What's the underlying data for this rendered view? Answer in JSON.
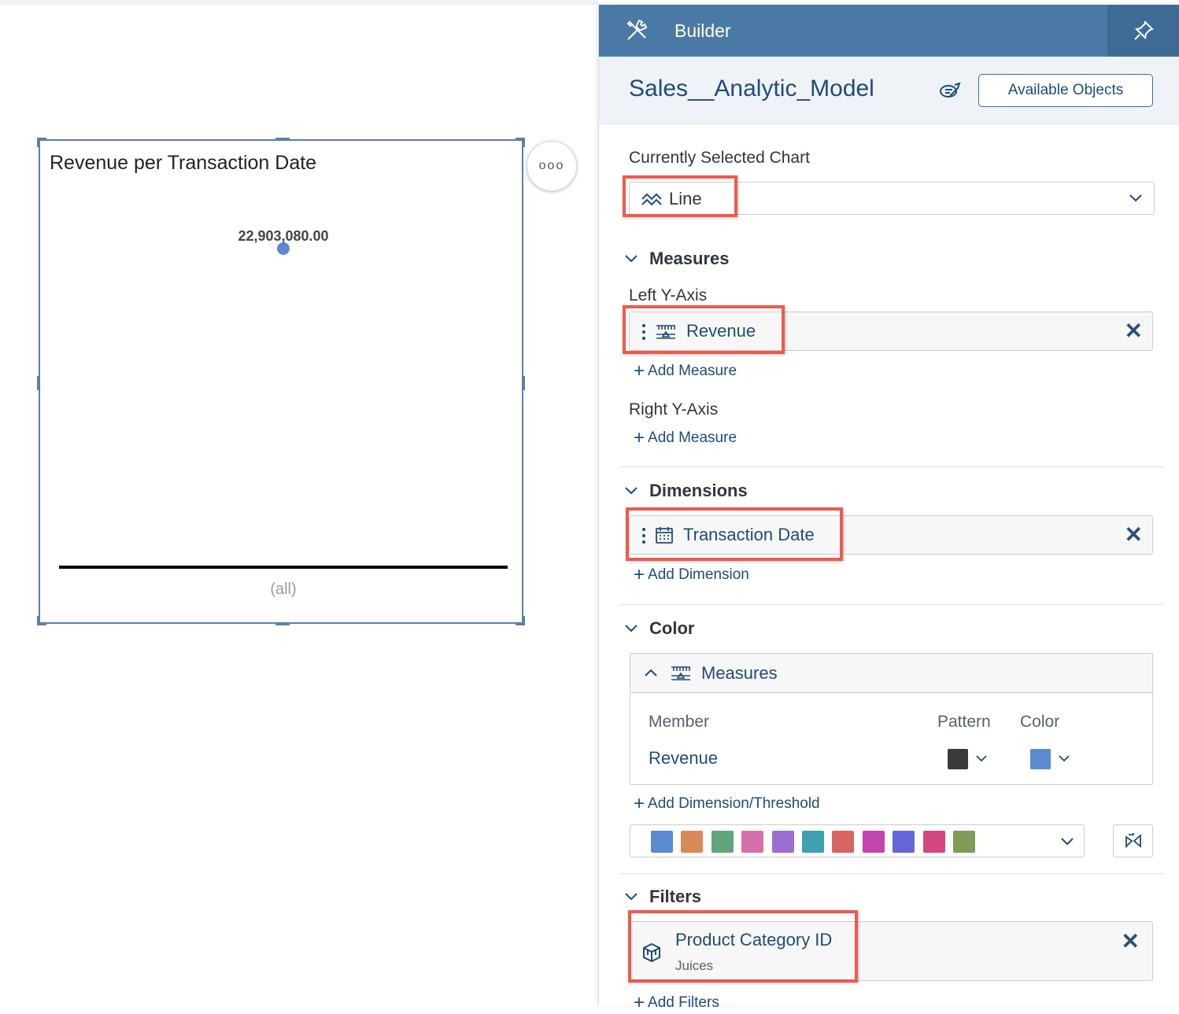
{
  "chart": {
    "title": "Revenue per Transaction Date",
    "more_label": "ooo"
  },
  "chart_data": {
    "type": "line",
    "title": "Revenue per Transaction Date",
    "categories": [
      "(all)"
    ],
    "series": [
      {
        "values": [
          22903080.0
        ]
      }
    ],
    "data_labels": [
      "22,903,080.00"
    ]
  },
  "builder": {
    "title": "Builder",
    "model_name": "Sales__Analytic_Model",
    "available_objects_label": "Available Objects",
    "currently_selected_chart_label": "Currently Selected Chart",
    "chart_type": "Line",
    "measures": {
      "heading": "Measures",
      "left_axis_label": "Left Y-Axis",
      "left_axis_item": "Revenue",
      "add_measure_left": "Add Measure",
      "right_axis_label": "Right Y-Axis",
      "add_measure_right": "Add Measure"
    },
    "dimensions": {
      "heading": "Dimensions",
      "item": "Transaction Date",
      "add_dimension": "Add Dimension"
    },
    "color": {
      "heading": "Color",
      "group_label": "Measures",
      "col_member": "Member",
      "col_pattern": "Pattern",
      "col_color": "Color",
      "member": "Revenue",
      "pattern_color": "#3a3a3a",
      "member_color": "#5b8ad0",
      "add_dimension_threshold": "Add Dimension/Threshold",
      "palette": [
        "#5b8ad0",
        "#d98a55",
        "#61a47a",
        "#d570ad",
        "#9b6ed0",
        "#3fa0b1",
        "#d86464",
        "#c245ad",
        "#6567d8",
        "#d2487f",
        "#7f9d57"
      ]
    },
    "filters": {
      "heading": "Filters",
      "item": "Product Category ID",
      "item_value": "Juices",
      "add_filters": "Add Filters"
    }
  },
  "colors": {
    "accent": "#4a79a6",
    "highlight": "#ef5a4d",
    "link": "#1f4b7a"
  }
}
